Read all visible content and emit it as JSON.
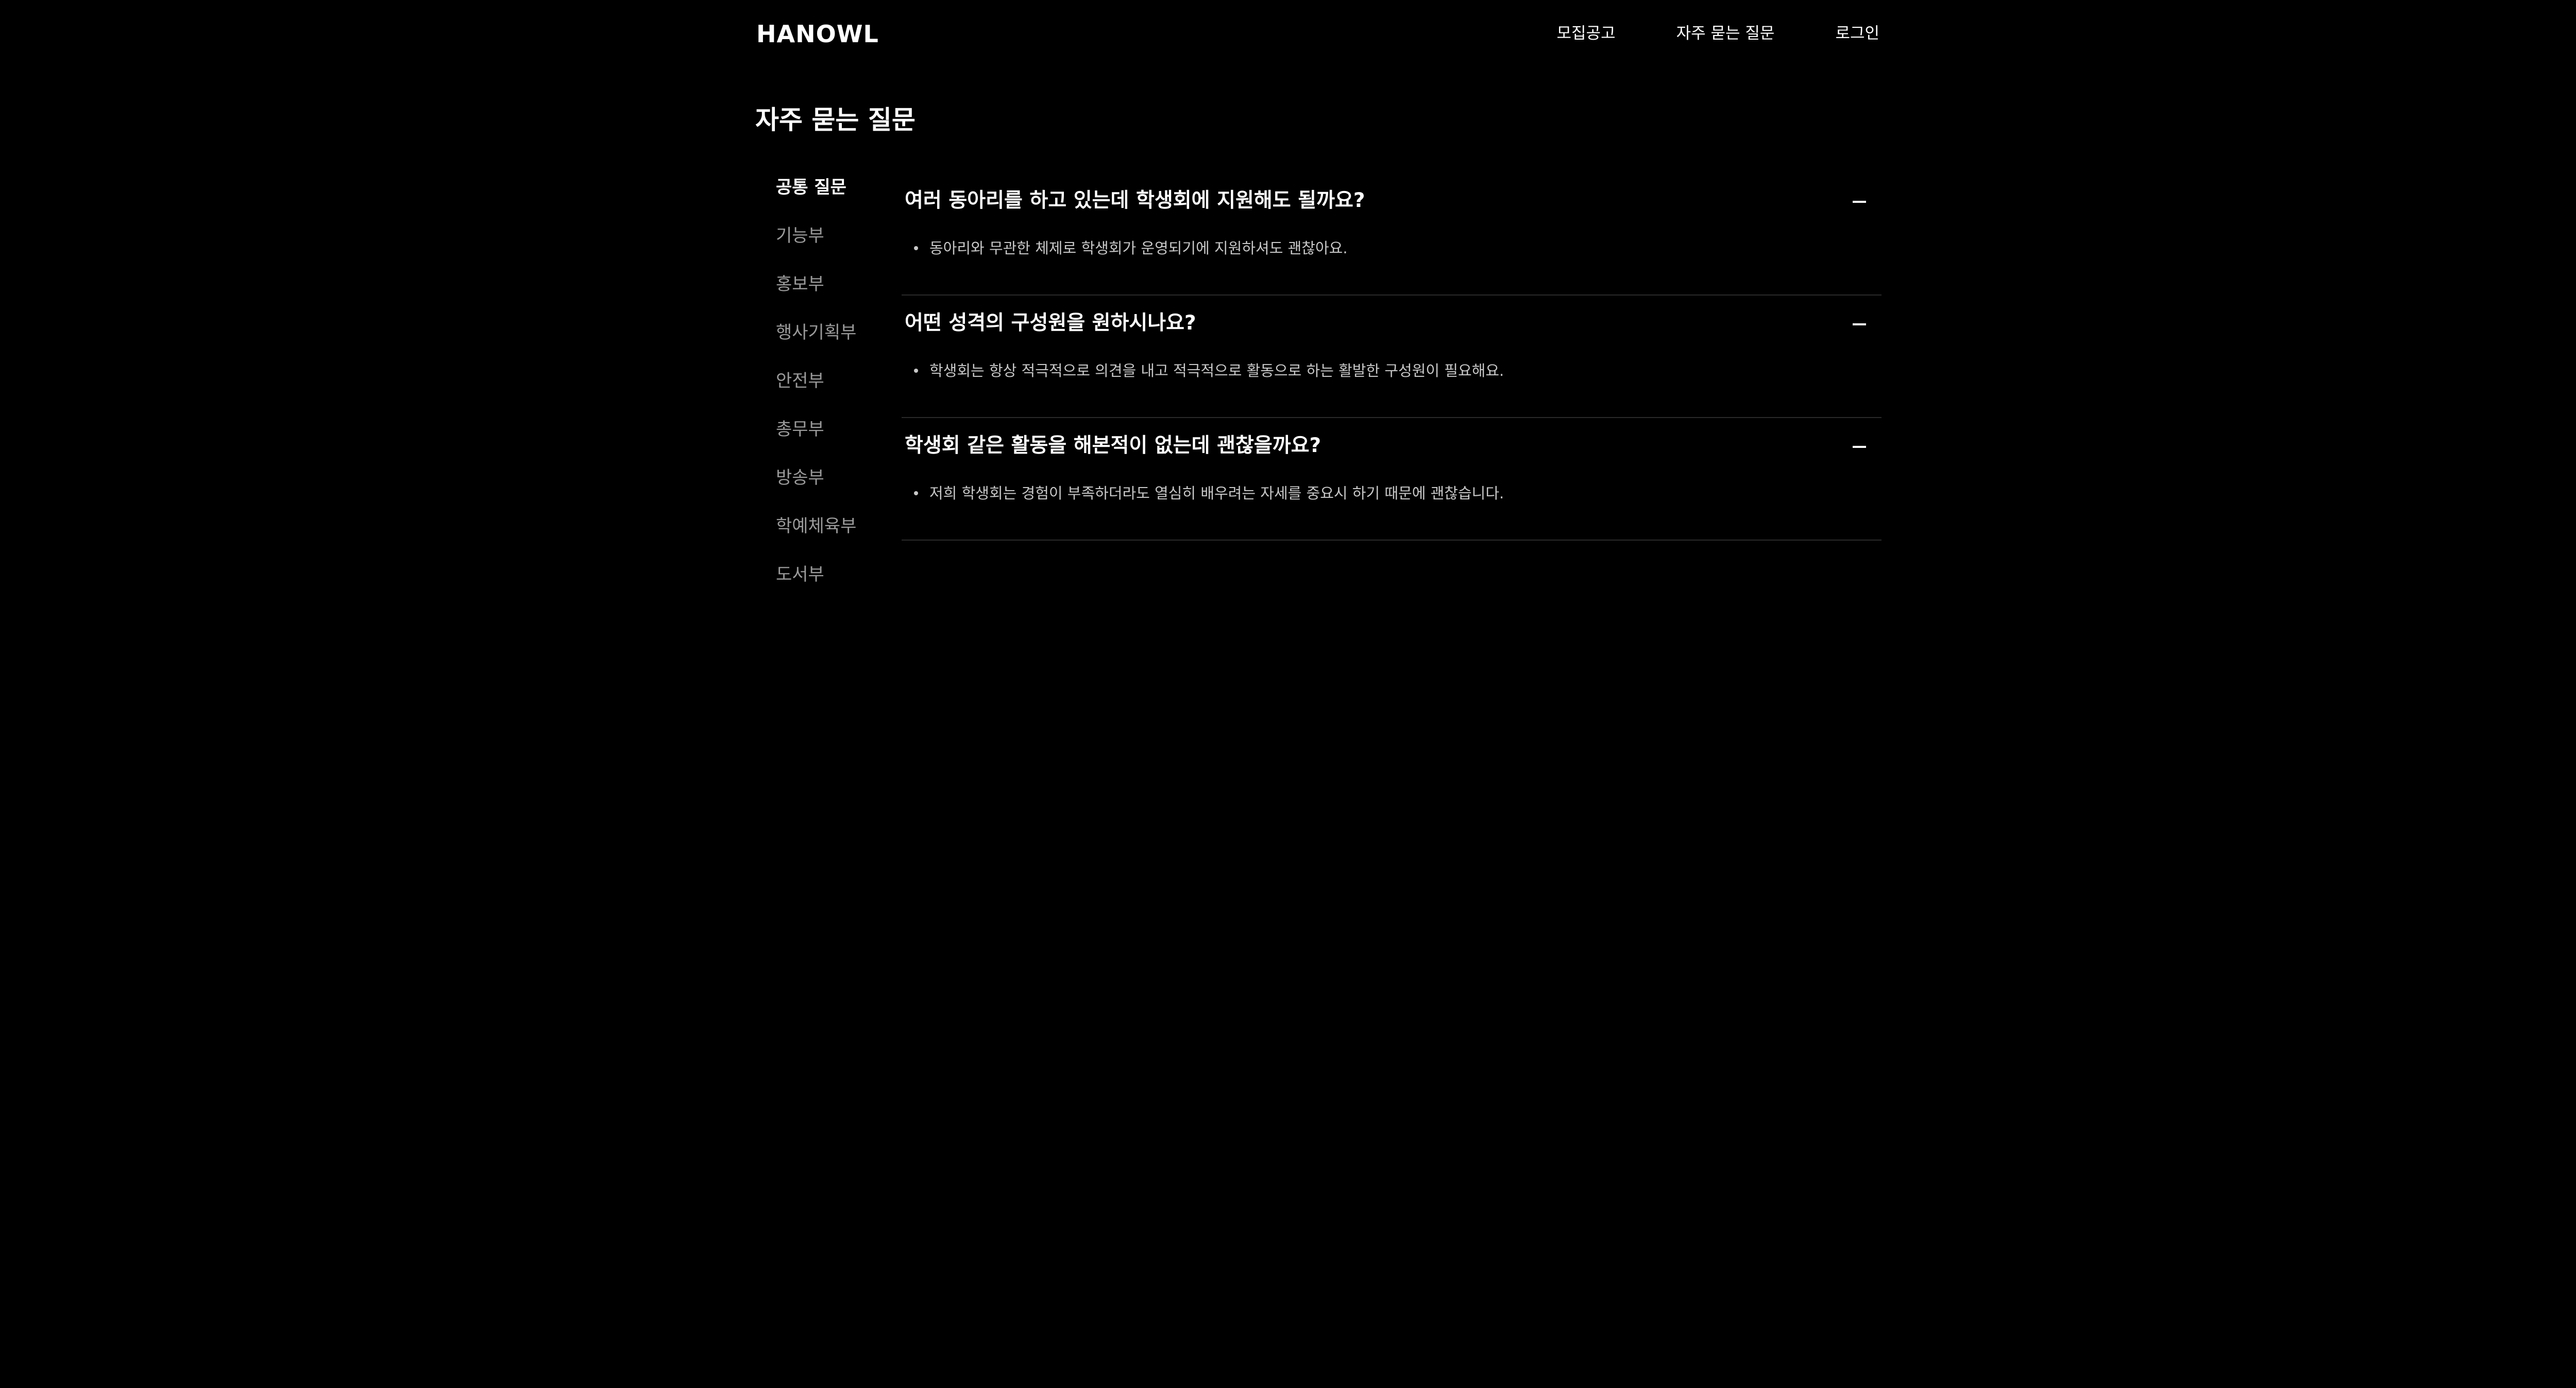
{
  "header": {
    "logo": "HANOWL",
    "nav": [
      {
        "label": "모집공고"
      },
      {
        "label": "자주 묻는 질문"
      },
      {
        "label": "로그인"
      }
    ]
  },
  "page_title": "자주 묻는 질문",
  "sidebar": {
    "items": [
      {
        "label": "공통 질문",
        "active": true
      },
      {
        "label": "기능부"
      },
      {
        "label": "홍보부"
      },
      {
        "label": "행사기획부"
      },
      {
        "label": "안전부"
      },
      {
        "label": "총무부"
      },
      {
        "label": "방송부"
      },
      {
        "label": "학예체육부"
      },
      {
        "label": "도서부"
      }
    ]
  },
  "faq": [
    {
      "question": "여러 동아리를 하고 있는데 학생회에 지원해도 될까요?",
      "answer": "동아리와 무관한 체제로 학생회가 운영되기에 지원하셔도 괜찮아요.",
      "toggle_icon": "minus-icon"
    },
    {
      "question": "어떤 성격의 구성원을 원하시나요?",
      "answer": "학생회는 항상 적극적으로 의견을 내고 적극적으로 활동으로 하는 활발한 구성원이 필요해요.",
      "toggle_icon": "minus-icon"
    },
    {
      "question": "학생회 같은 활동을 해본적이 없는데 괜찮을까요?",
      "answer": "저희 학생회는 경험이 부족하더라도 열심히 배우려는 자세를 중요시 하기 때문에 괜찮습니다.",
      "toggle_icon": "minus-icon"
    }
  ],
  "colors": {
    "background": "#000000",
    "text_primary": "#ffffff",
    "text_muted": "#9a9a9a",
    "divider": "#2a2a2a"
  }
}
